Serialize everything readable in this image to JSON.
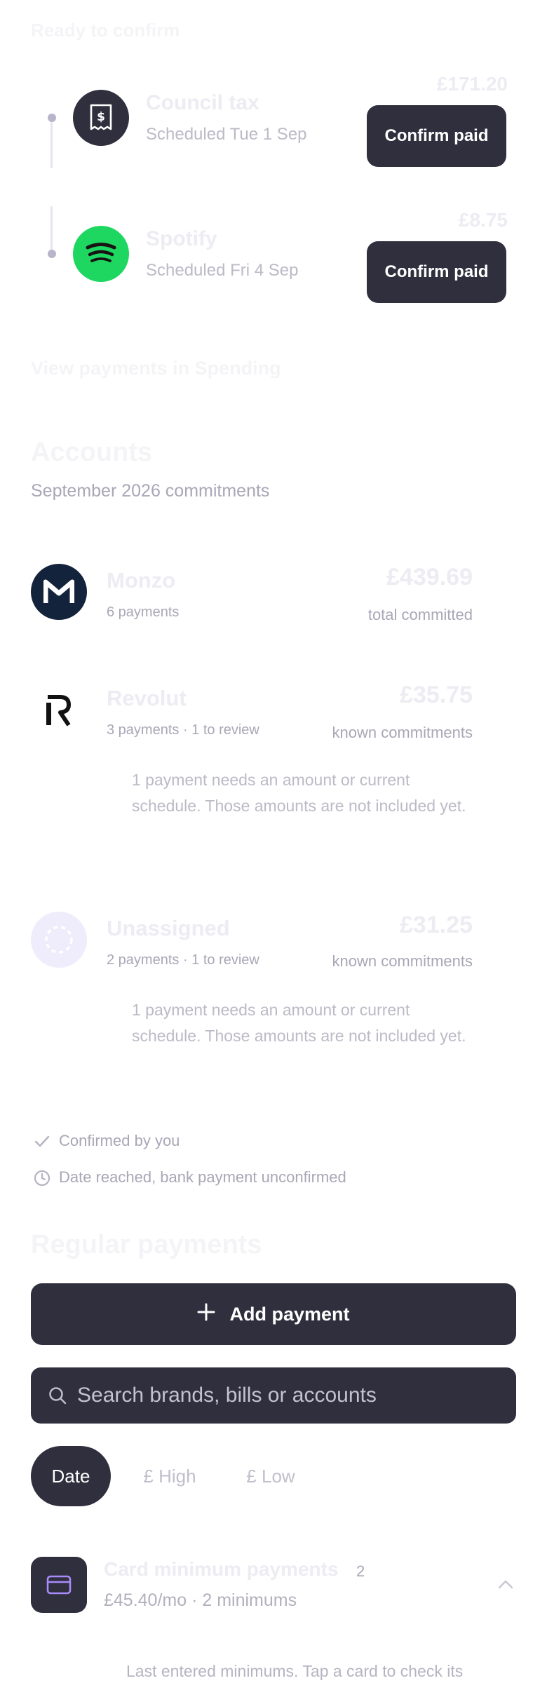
{
  "ready": {
    "heading": "Ready to confirm",
    "items": [
      {
        "name": "Council tax",
        "schedule": "Scheduled Tue 1 Sep",
        "amount": "£171.20",
        "button": "Confirm paid",
        "icon": "receipt-dollar-icon"
      },
      {
        "name": "Spotify",
        "schedule": "Scheduled Fri 4 Sep",
        "amount": "£8.75",
        "button": "Confirm paid",
        "icon": "spotify-logo-icon"
      }
    ],
    "view_link": "View payments in Spending"
  },
  "accounts": {
    "heading": "Accounts",
    "subtitle": "September 2026 commitments",
    "items": [
      {
        "name": "Monzo",
        "meta": "6 payments",
        "amount": "£439.69",
        "amount_label": "total committed",
        "note": ""
      },
      {
        "name": "Revolut",
        "meta": "3 payments · 1 to review",
        "amount": "£35.75",
        "amount_label": "known commitments",
        "note": "1 payment needs an amount or current schedule. Those amounts are not included yet."
      },
      {
        "name": "Unassigned",
        "meta": "2 payments · 1 to review",
        "amount": "£31.25",
        "amount_label": "known commitments",
        "note": "1 payment needs an amount or current schedule. Those amounts are not included yet."
      }
    ],
    "legend": [
      {
        "label": "Confirmed by you",
        "icon": "check-icon"
      },
      {
        "label": "Date reached, bank payment unconfirmed",
        "icon": "clock-icon"
      }
    ]
  },
  "regular": {
    "heading": "Regular payments",
    "add_button": "Add payment",
    "search_placeholder": "Search brands, bills or accounts",
    "sort_options": [
      "Date",
      "£ High",
      "£ Low"
    ],
    "selected_sort": "Date",
    "group": {
      "title": "Card minimum payments",
      "count": "2",
      "summary": "£45.40/mo · 2 minimums",
      "footnote": "Last entered minimums. Tap a card to check its"
    }
  },
  "colors": {
    "dark": "#302f3e",
    "spotify": "#1ed760",
    "monzo": "#14233c",
    "unassigned_bg": "#efedfb",
    "card_icon": "#a78bfa"
  }
}
